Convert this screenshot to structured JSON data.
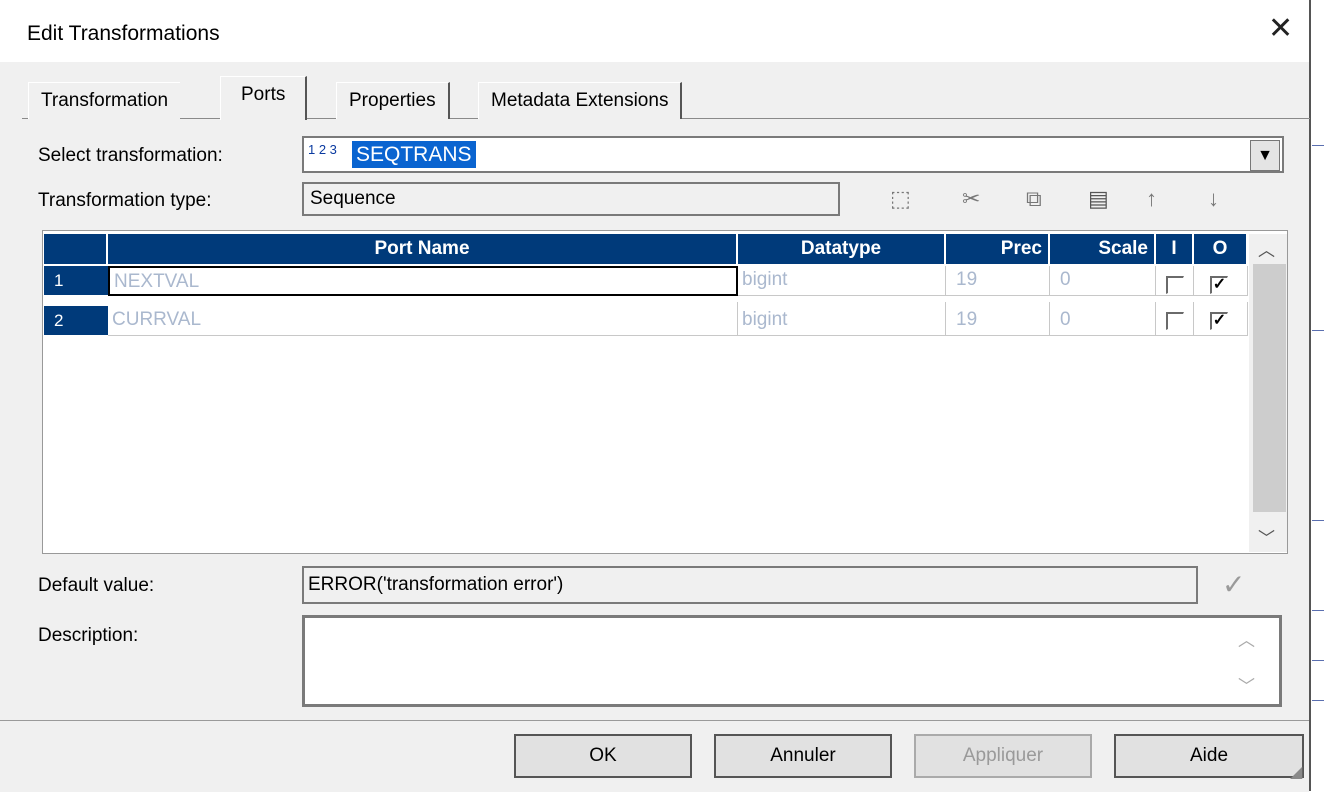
{
  "window": {
    "title": "Edit Transformations",
    "close_glyph": "✕"
  },
  "tabs": [
    "Transformation",
    "Ports",
    "Properties",
    "Metadata Extensions"
  ],
  "active_tab": "Ports",
  "form": {
    "select_label": "Select transformation:",
    "select_icon_text": "1 2 3",
    "select_value": "SEQTRANS",
    "type_label": "Transformation type:",
    "type_value": "Sequence",
    "default_label": "Default value:",
    "default_value": "ERROR('transformation error')",
    "description_label": "Description:",
    "description_value": ""
  },
  "toolbar": {
    "icons": [
      "new-port-icon",
      "cut-icon",
      "copy-icon",
      "paste-icon",
      "move-up-icon",
      "move-down-icon"
    ],
    "validate_icon": "checkmark-icon"
  },
  "grid": {
    "columns": [
      "Port Name",
      "Datatype",
      "Prec",
      "Scale",
      "I",
      "O"
    ],
    "rows": [
      {
        "num": "1",
        "name": "NEXTVAL",
        "datatype": "bigint",
        "prec": "19",
        "scale": "0",
        "input": false,
        "output": true
      },
      {
        "num": "2",
        "name": "CURRVAL",
        "datatype": "bigint",
        "prec": "19",
        "scale": "0",
        "input": false,
        "output": true
      }
    ]
  },
  "buttons": {
    "ok": "OK",
    "cancel": "Annuler",
    "apply": "Appliquer",
    "help": "Aide"
  },
  "colors": {
    "header_bg": "#003a7a",
    "selection": "#0a64d0",
    "cell_text": "#aab8ce"
  }
}
